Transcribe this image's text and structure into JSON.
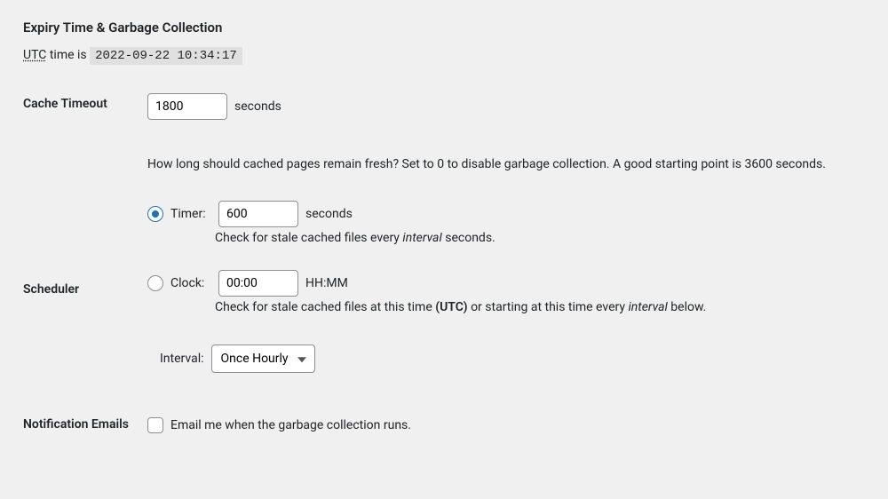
{
  "section_title": "Expiry Time & Garbage Collection",
  "utc": {
    "abbr": "UTC",
    "prefix": " time is ",
    "time": "2022-09-22 10:34:17"
  },
  "cache_timeout": {
    "label": "Cache Timeout",
    "value": "1800",
    "unit": "seconds",
    "desc": "How long should cached pages remain fresh? Set to 0 to disable garbage collection. A good starting point is 3600 seconds."
  },
  "scheduler": {
    "label": "Scheduler",
    "timer": {
      "radio_label": "Timer:",
      "value": "600",
      "unit": "seconds",
      "desc_pre": "Check for stale cached files every ",
      "desc_em": "interval",
      "desc_post": " seconds."
    },
    "clock": {
      "radio_label": "Clock:",
      "value": "00:00",
      "unit": "HH:MM",
      "desc_pre": "Check for stale cached files at this time ",
      "desc_strong": "(UTC)",
      "desc_mid": " or starting at this time every ",
      "desc_em": "interval",
      "desc_post": " below."
    },
    "interval": {
      "label": "Interval:",
      "selected": "Once Hourly"
    }
  },
  "notification": {
    "label": "Notification Emails",
    "checkbox_label": "Email me when the garbage collection runs."
  }
}
